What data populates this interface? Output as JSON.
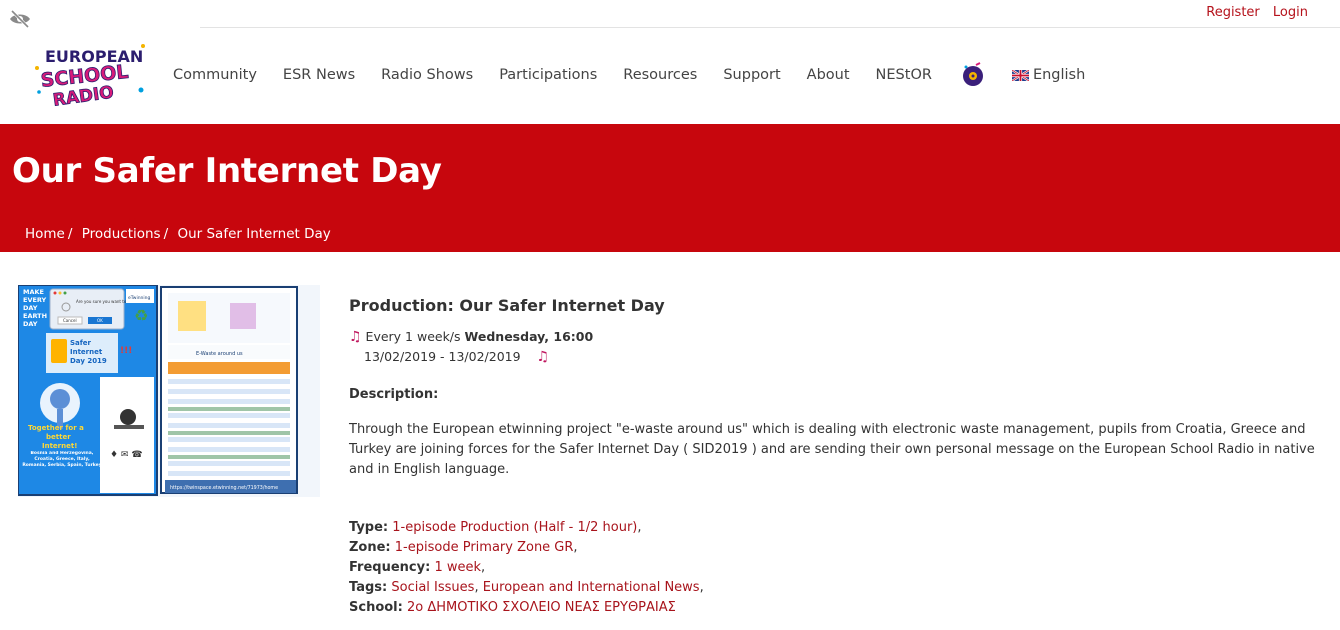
{
  "auth": {
    "register": "Register",
    "login": "Login"
  },
  "nav": {
    "items": [
      "Community",
      "ESR News",
      "Radio Shows",
      "Participations",
      "Resources",
      "Support",
      "About",
      "NEStOR"
    ],
    "language": "English"
  },
  "logo": {
    "line1": "EUROPEAN",
    "line2": "SCHOOL",
    "line3": "RADIO"
  },
  "hero": {
    "title": "Our Safer Internet Day",
    "breadcrumb": [
      "Home",
      "Productions",
      "Our Safer Internet Day"
    ]
  },
  "poster": {
    "left_text": [
      "MAKE",
      "EVERY",
      "DAY",
      "EARTH",
      "DAY"
    ],
    "dialog_q": "Are you sure you want to end waste?",
    "cancel": "Cancel",
    "ok": "OK",
    "twinning": "eTwinning",
    "sid": [
      "Safer",
      "Internet",
      "Day 2019"
    ],
    "together": [
      "Together for a",
      "better",
      "Internet!"
    ],
    "countries": "Bosnia and Herzegovina, Croatia, Greece, Italy, Romania, Serbia, Spain, Turkey",
    "doc_header": "E-Waste around us",
    "url": "https://twinspace.etwinning.net/71973/home"
  },
  "production": {
    "title": "Production: Our Safer Internet Day",
    "schedule_prefix": "Every 1 week/s",
    "schedule_day": "Wednesday, 16:00",
    "date_range": "13/02/2019 - 13/02/2019",
    "description_label": "Description:",
    "description": "Through the European etwinning project \"e-waste around us\" which is dealing with electronic waste management, pupils from Croatia, Greece and Turkey are joining forces for the Safer Internet Day ( SID2019 ) and are sending their own personal message on the European School Radio in native and in English language."
  },
  "meta": {
    "type_label": "Type:",
    "type_value": "1-episode Production (Half - 1/2 hour)",
    "zone_label": "Zone:",
    "zone_value": "1-episode Primary Zone GR",
    "frequency_label": "Frequency:",
    "frequency_value": "1 week",
    "tags_label": "Tags:",
    "tags": [
      "Social Issues",
      "European and International News"
    ],
    "school_label": "School:",
    "school_value": "2ο ΔΗΜΟΤΙΚΟ ΣΧΟΛΕΙΟ ΝΕΑΣ ΕΡΥΘΡΑΙΑΣ"
  },
  "colors": {
    "brand_red": "#c7060d",
    "link_red": "#a8141c",
    "note_pink": "#c0185f"
  }
}
